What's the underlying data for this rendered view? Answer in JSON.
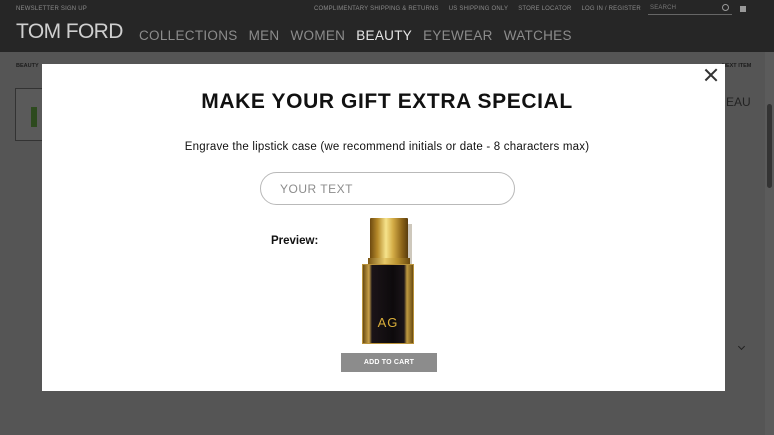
{
  "header": {
    "newsletter_link": "NEWSLETTER SIGN UP",
    "util_links": [
      "COMPLIMENTARY SHIPPING & RETURNS",
      "US SHIPPING ONLY",
      "STORE LOCATOR",
      "LOG IN / REGISTER"
    ],
    "search_placeholder": "SEARCH",
    "logo": "TOM FORD",
    "nav": [
      "COLLECTIONS",
      "MEN",
      "WOMEN",
      "BEAUTY",
      "EYEWEAR",
      "WATCHES"
    ],
    "active_nav": "BEAUTY"
  },
  "page": {
    "breadcrumb": "BEAUTY",
    "next_item": "NEXT ITEM",
    "side_title_fragment": "EAU"
  },
  "modal": {
    "title": "MAKE YOUR GIFT EXTRA SPECIAL",
    "subtitle": "Engrave the lipstick case (we recommend initials or date  - 8 characters max)",
    "input_placeholder": "YOUR TEXT",
    "preview_label": "Preview:",
    "engraving_preview": "AG",
    "add_to_cart": "ADD TO CART"
  },
  "colors": {
    "modal_bg": "#ffffff",
    "overlay": "#555555",
    "header_bg": "#262626",
    "button_bg": "#8c8c8c",
    "gold": "#d9ad3a"
  }
}
